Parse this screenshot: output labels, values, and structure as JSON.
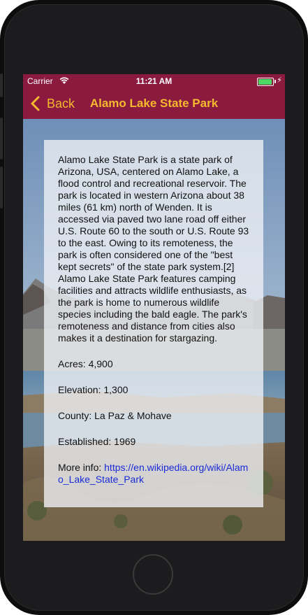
{
  "status_bar": {
    "carrier": "Carrier",
    "time": "11:21 AM",
    "wifi_icon": "wifi-icon",
    "battery_icon": "battery-full-icon",
    "charging_icon": "charging-bolt-icon"
  },
  "nav": {
    "back_label": "Back",
    "back_icon": "chevron-left-icon",
    "title": "Alamo Lake State Park"
  },
  "park": {
    "description": "Alamo Lake State Park is a state park of Arizona, USA, centered on Alamo Lake, a flood control and recreational reservoir. The park is located in western Arizona about 38 miles (61 km) north of Wenden. It is accessed via paved two lane road off either U.S. Route 60 to the south or U.S. Route 93 to the east. Owing to its remoteness, the park is often considered one of the \"best kept secrets\" of the state park system.[2]  Alamo Lake State Park features camping facilities and attracts wildlife enthusiasts, as the park is home to numerous wildlife species including the bald eagle. The park's remoteness and distance from cities also makes it a destination for stargazing.",
    "acres": "Acres: 4,900",
    "elevation": "Elevation: 1,300",
    "county": "County: La Paz & Mohave",
    "established": "Established: 1969",
    "more_info_label": "More info: ",
    "more_info_url": "https://en.wikipedia.org/wiki/Alamo_Lake_State_Park"
  },
  "colors": {
    "bar_background": "#8a1b3f",
    "accent": "#f5b82e",
    "link": "#1a2bd6"
  }
}
